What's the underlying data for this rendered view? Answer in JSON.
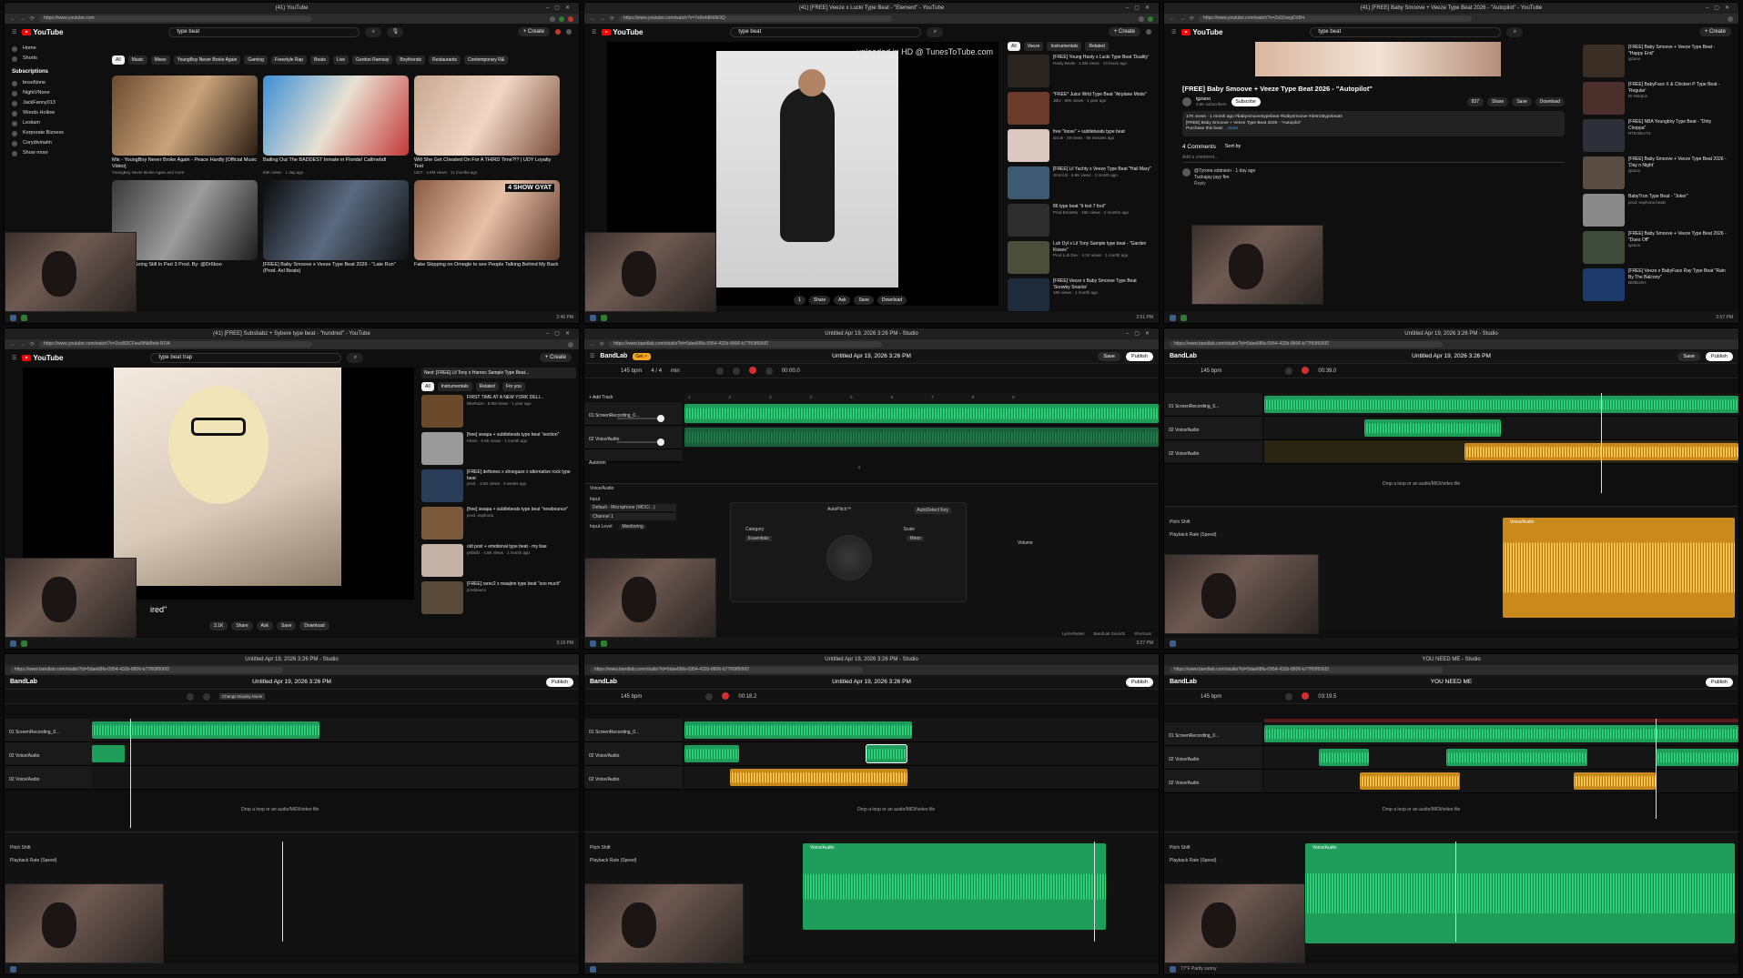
{
  "panels": {
    "p1": {
      "tab_title": "(41) YouTube",
      "url": "https://www.youtube.com",
      "search": "type beat",
      "create": "+ Create",
      "sidebar": [
        "Home",
        "Shorts"
      ],
      "subs_heading": "Subscriptions",
      "subs": [
        "bnsoNone",
        "NightVNone",
        "JackFanny013",
        "Woods Hollow",
        "Lexiiam",
        "Korporate Bizness",
        "Corydivinatin",
        "Show more"
      ],
      "chips": [
        "All",
        "Music",
        "Mixes",
        "YoungBoy Never Broke Again",
        "Gaming",
        "Freestyle Rap",
        "Beats",
        "Live",
        "Gordon Ramsay",
        "Boyfriends",
        "Restaurants",
        "Contemporary R&"
      ],
      "videos": [
        {
          "title": "Mix - YoungBoy Never Broke Again - Peace Hardly [Official Music Video]",
          "meta": "YoungBoy Never Broke Again and more"
        },
        {
          "title": "Bailing Out The BADDEST Inmate in Florida! Callmebdl",
          "meta": "83K views · 1 day ago"
        },
        {
          "title": "Will She Get Cheated On For A THIRD Time?!? | UDY Loyalty Test",
          "meta": "UDY · 4.8M views · 11 months ago"
        },
        {
          "title": "Choppa - Going Still In Part 3 Prod. By: @Dr6boo",
          "meta": ""
        },
        {
          "title": "[FREE] Baby Smoove x Veeze Type Beat 2026 - \"Late Run\" (Prod. Axl Beats)",
          "meta": ""
        },
        {
          "title": "Fake Skipping on Omegle to see People Talking Behind My Back",
          "meta": ""
        }
      ],
      "badge": "4 SHOW GYAT",
      "time": "2:46 PM"
    },
    "p2": {
      "tab_title": "(41) [FREE] Veeze x Lucki Type Beat - \"Element\" - YouTube",
      "url": "https://www.youtube.com/watch?v=7xRefdRt0E9Q",
      "search": "type beat",
      "create": "+ Create",
      "overlay": "uploaded in HD @ TunesToTube.com",
      "chips": [
        "All",
        "Veeze",
        "Instrumentals",
        "Related"
      ],
      "recs": [
        {
          "title": "[FREE] Young Hasty x Lucki Type Beat 'Duality'",
          "meta": "Hasty Beats · 1.5M views · 13 hours ago"
        },
        {
          "title": "*FREE* Juice Wrld Type Beat \"Airplane Mode\"",
          "meta": "JBU · 90K views · 1 year ago"
        },
        {
          "title": "free \"loose\" + subtlebeats type beat",
          "meta": "arcuk · 29 views · 56 minutes ago"
        },
        {
          "title": "[FREE] Lil Yachty x Veeze Type Beat \"Hail Mary\"",
          "meta": "Jimmi B · 5.6K views · 1 month ago"
        },
        {
          "title": "86 type beat \"it lost 7 fool\"",
          "meta": "Prod Ema00x · 10K views · 2 months ago"
        },
        {
          "title": "Luh Dyl x Lil Tony Sample type beat - \"Garden Kisses\"",
          "meta": "Prod Luh Dev · 4.1K views · 1 month ago"
        },
        {
          "title": "[FREE] Veeze x Baby Smoove Type Beat 'Snowby Snacks'",
          "meta": "180 views · 1 month ago"
        }
      ],
      "actions": [
        "1",
        "Share",
        "Ask",
        "Save",
        "Download"
      ],
      "time": "2:51 PM"
    },
    "p3": {
      "tab_title": "(41) [FREE] Baby Smoove + Veeze Type Beat 2026 - \"Autopilot\" - YouTube",
      "url": "https://www.youtube.com/watch?v=Zs0ZoegDXB4",
      "search": "type beat",
      "create": "+ Create",
      "video_title": "[FREE] Baby Smoove + Veeze Type Beat 2026 - \"Autopilot\"",
      "channel": "igzaoo",
      "subscribers": "3.5K subscribers",
      "subscribe": "Subscribe",
      "likes": "837",
      "desc_meta": "17K views · 1 month ago  #babysmoovetypebeat #babysmoove #detroittypebeats",
      "desc_line": "[FREE] Baby Smoove + Veeze Type Beat 2026 - \"Autopilot\"",
      "purchase": "Purchase this beat:",
      "more": "...more",
      "comments_count": "4 Comments",
      "sort": "Sort by",
      "add_comment": "Add a comment...",
      "comment_user": "@Tyrone.robinson · 1 day ago",
      "comment_text": "Tuckajay jayy fire",
      "reply": "Reply",
      "actions": [
        "837",
        "Share",
        "Save",
        "Download"
      ],
      "recs": [
        {
          "title": "[FREE] Baby Smoove + Veeze Type Beat - \"Happy End\"",
          "meta": "igzaoo"
        },
        {
          "title": "[FREE] BabyFace X & Chicken P Type Beat - 'Regular'",
          "meta": "Dr Morpus"
        },
        {
          "title": "[FREE] NBA Youngboy Type Beat - \"Dirty Choppa\"",
          "meta": "RTB BEATS"
        },
        {
          "title": "[FREE] Baby Smoove + Veeze Type Beat 2026 - 'Day n Night'",
          "meta": "igzaoo"
        },
        {
          "title": "BabyTron Type Beat - \"Joker\"",
          "meta": "prod. euphoria beatz"
        },
        {
          "title": "[FREE] Baby Smoove + Veeze Type Beat 2026 - \"Dues Off\"",
          "meta": "igzaoo"
        },
        {
          "title": "[FREE] Veeze x BabyFace Ray Type Beat \"Rain By The Balcony\"",
          "meta": "BOBLISH"
        }
      ],
      "time": "2:57 PM"
    },
    "p4": {
      "tab_title": "(41) [FREE] Subsbabz + Sybere type beat - \"hundred\" - YouTube",
      "url": "https://www.youtube.com/watch?v=2vuBDCFwuNNbBokt-ROA",
      "search": "type beat trap",
      "create": "+ Create",
      "next_label": "Next: [FREE] Lil Tony x Harnoc Sample Type Beat...",
      "chips": [
        "All",
        "Instrumentals",
        "Related",
        "For you"
      ],
      "recs": [
        {
          "title": "FIRST TIME AT A NEW YORK DELI...",
          "meta": "Bluehaze · 8.5M views · 1 year ago"
        },
        {
          "title": "[free] swapa + subtlebeats type beat \"section\"",
          "meta": "Kbsm · 5.6K views · 1 month ago"
        },
        {
          "title": "[FREE] deftones x shoegaze x alternative rock type beat",
          "meta": "prod. · 2.5K views · 3 weeks ago"
        },
        {
          "title": "[free] swapa + subtlebeats type beat \"newbounce\"",
          "meta": "prod. euphoria"
        },
        {
          "title": "old post + emotional type beat - my bae",
          "meta": "pebbilz · 4.5K views · 1 month ago"
        },
        {
          "title": "[FREE] rarec2 x maajinn type beat \"soo much\"",
          "meta": "prodsauce"
        }
      ],
      "caption": "ired\"",
      "actions": [
        "3.1K",
        "Share",
        "Ask",
        "Save",
        "Download"
      ],
      "time": "3:19 PM"
    },
    "p5": {
      "tab_title": "Untitled Apr 19, 2026 3:26 PM - Studio",
      "url": "https://www.bandlab.com/studio?id=5dae68fa-0954-432b-8806-b77f69f506f2",
      "logo": "BandLab",
      "badge": "Get ✓",
      "project_title": "Untitled Apr 19, 2026 3:26 PM",
      "save": "Save",
      "publish": "Publish",
      "bpm": "145 bpm",
      "sig": "4 / 4",
      "key": "min",
      "time": "00:00.0",
      "add_track": "+ Add Track",
      "tracks": [
        "01 ScreenRecording_0...",
        "02 Voice/Audio",
        "Autotrim"
      ],
      "input_label": "Input",
      "input_device": "Default - Microphone (WDC/...)",
      "channel": "Channel 1",
      "input_level": "Input Level",
      "monitoring": "Monitoring",
      "fx_name": "AutoPitch™",
      "autodetect": "AutoDetect Key",
      "category": "Category",
      "category_val": "Essentials",
      "scale": "Scale",
      "scale_val": "Minor",
      "volume": "Volume",
      "editor_track": "Voice/Audio",
      "status": [
        "Lyrics/Notes",
        "BandLab Sounds",
        "Shortcuts"
      ],
      "clock": "3:27 PM"
    },
    "p6": {
      "tab_title": "Untitled Apr 19, 2026 3:26 PM - Studio",
      "project_title": "Untitled Apr 19, 2026 3:26 PM",
      "time": "00:39.0",
      "drop": "Drop a loop or an audio/MIDI/video file",
      "pitch_shift": "Pitch Shift",
      "playback_rate": "Playback Rate (Speed)",
      "clip_label": "Voice/Audio"
    },
    "p7": {
      "tab_title": "Untitled Apr 19, 2026 3:26 PM - Studio",
      "project_title": "Untitled Apr 19, 2026 3:26 PM",
      "tooltip": "Change Display Mode",
      "drop": "Drop a loop or an audio/MIDI/video file",
      "pitch_shift": "Pitch Shift",
      "playback_rate": "Playback Rate (Speed)"
    },
    "p8": {
      "tab_title": "Untitled Apr 19, 2026 3:26 PM - Studio",
      "project_title": "Untitled Apr 19, 2026 3:26 PM",
      "time": "00:18.2",
      "drop": "Drop a loop or an audio/MIDI/video file",
      "pitch_shift": "Pitch Shift",
      "playback_rate": "Playback Rate (Speed)",
      "clip_label": "Voice/Audio"
    },
    "p9": {
      "tab_title": "YOU NEED ME - Studio",
      "project_title": "YOU NEED ME",
      "time": "03:19.5",
      "drop": "Drop a loop or an audio/MIDI/video file",
      "pitch_shift": "Pitch Shift",
      "playback_rate": "Playback Rate (Speed)",
      "clip_label": "Voice/Audio",
      "taskbar_text": "77°F Partly sunny"
    }
  },
  "colors": {
    "yt_red": "#ff0000",
    "bl_green": "#1f9d5b",
    "bl_yellow": "#c98a1b",
    "rec_red": "#d32f2f"
  }
}
